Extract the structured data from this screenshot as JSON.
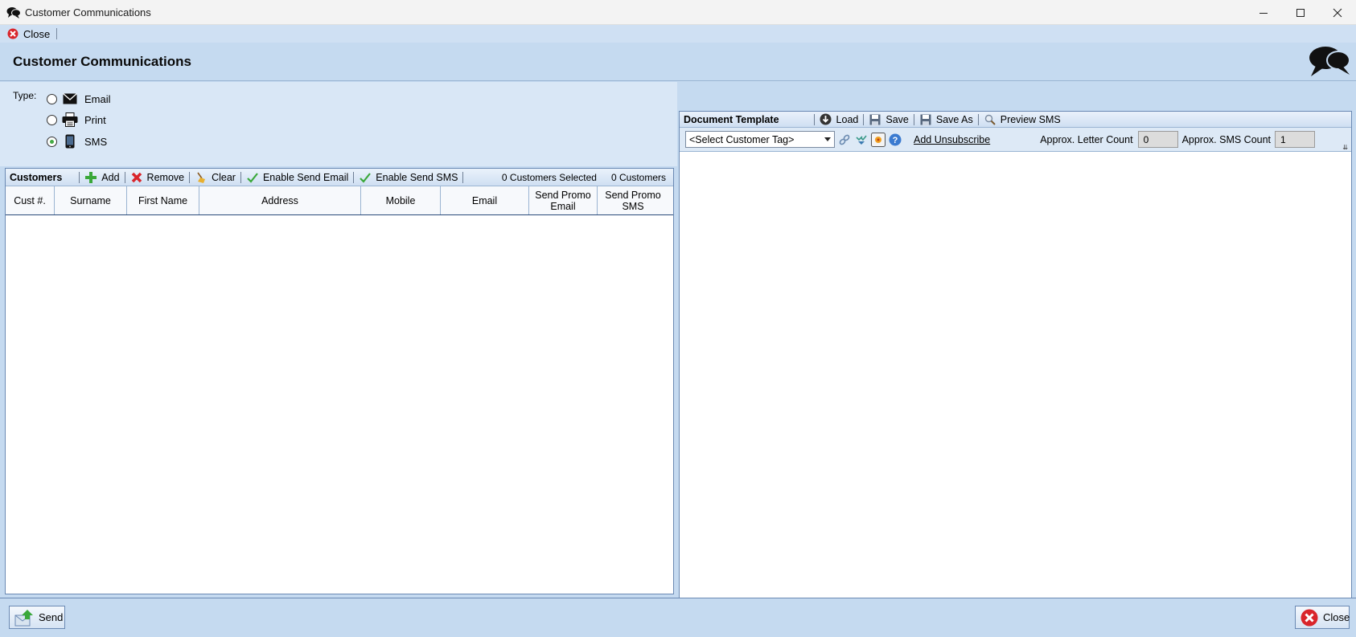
{
  "window": {
    "title": "Customer Communications"
  },
  "topbar": {
    "close_label": "Close"
  },
  "header": {
    "title": "Customer Communications"
  },
  "type_section": {
    "label": "Type:",
    "options": [
      {
        "label": "Email",
        "icon": "envelope-icon",
        "checked": false
      },
      {
        "label": "Print",
        "icon": "printer-icon",
        "checked": false
      },
      {
        "label": "SMS",
        "icon": "mobile-phone-icon",
        "checked": true
      }
    ]
  },
  "customers": {
    "title": "Customers",
    "buttons": {
      "add": "Add",
      "remove": "Remove",
      "clear": "Clear",
      "enable_email": "Enable Send Email",
      "enable_sms": "Enable Send SMS"
    },
    "selected_count": "0 Customers Selected",
    "total_count": "0 Customers",
    "columns": [
      "Cust #.",
      "Surname",
      "First Name",
      "Address",
      "Mobile",
      "Email",
      "Send Promo Email",
      "Send Promo SMS"
    ],
    "rows": []
  },
  "document_template": {
    "title": "Document Template",
    "buttons": {
      "load": "Load",
      "save": "Save",
      "save_as": "Save As",
      "preview": "Preview SMS"
    },
    "tag_select": {
      "value": "<Select Customer Tag>"
    },
    "add_unsubscribe": "Add Unsubscribe",
    "letter_count": {
      "label": "Approx. Letter Count",
      "value": "0"
    },
    "sms_count": {
      "label": "Approx. SMS Count",
      "value": "1"
    }
  },
  "bottom": {
    "send_label": "Send",
    "close_label": "Close"
  },
  "colors": {
    "panel_bg": "#c5daf0",
    "border": "#6a89b3",
    "close_red": "#d9252b",
    "send_green": "#3aa83a"
  }
}
